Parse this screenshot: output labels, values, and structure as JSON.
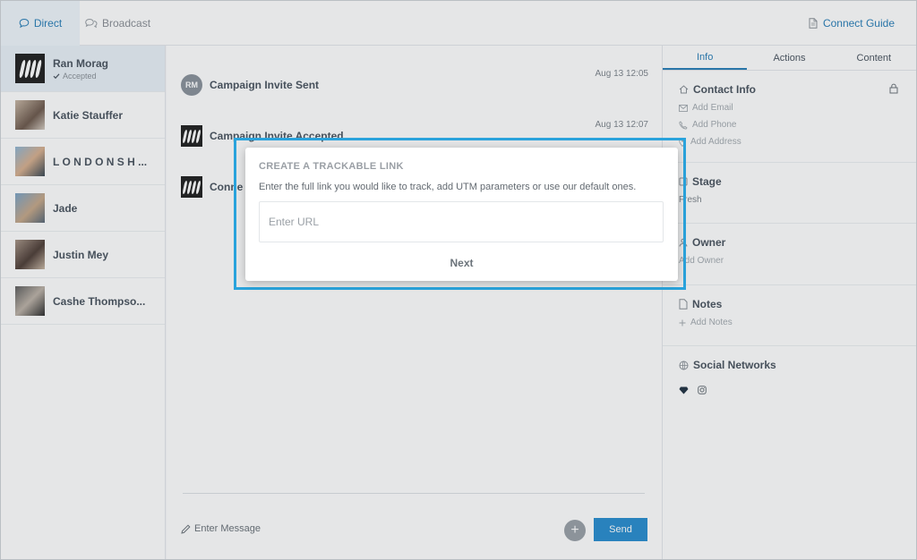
{
  "topbar": {
    "tabs": [
      {
        "label": "Direct",
        "icon": "chat-bubble-icon",
        "active": true
      },
      {
        "label": "Broadcast",
        "icon": "broadcast-icon",
        "active": false
      }
    ],
    "connect_guide": "Connect Guide"
  },
  "contacts": [
    {
      "name": "Ran Morag",
      "status": "Accepted",
      "active": true
    },
    {
      "name": "Katie Stauffer"
    },
    {
      "name": "L O N D O N S H ..."
    },
    {
      "name": "Jade"
    },
    {
      "name": "Justin Mey"
    },
    {
      "name": "Cashe Thompso..."
    }
  ],
  "chat": {
    "events": [
      {
        "avatar_initials": "RM",
        "title": "Campaign Invite Sent",
        "time": "Aug 13 12:05"
      },
      {
        "title": "Campaign Invite Accepted",
        "time": "Aug 13 12:07"
      },
      {
        "title": "Conne"
      }
    ],
    "composer_placeholder": "Enter Message",
    "send_label": "Send",
    "add_label": "+"
  },
  "right_panel": {
    "tabs": [
      "Info",
      "Actions",
      "Content"
    ],
    "contact_info": {
      "title": "Contact Info",
      "items": [
        "Add Email",
        "Add Phone",
        "Add Address"
      ]
    },
    "stage": {
      "title": "Stage",
      "value": "Fresh"
    },
    "owner": {
      "title": "Owner",
      "value": "Add Owner"
    },
    "notes": {
      "title": "Notes",
      "value": "Add Notes"
    },
    "social": {
      "title": "Social Networks"
    }
  },
  "modal": {
    "title": "CREATE A TRACKABLE LINK",
    "description": "Enter the full link you would like to track, add UTM parameters or use our default ones.",
    "url_placeholder": "Enter URL",
    "url_value": "",
    "next_label": "Next"
  },
  "colors": {
    "accent": "#2a7fb8",
    "send_button": "#2a8ed0",
    "highlight_border": "#2aa3dc"
  }
}
